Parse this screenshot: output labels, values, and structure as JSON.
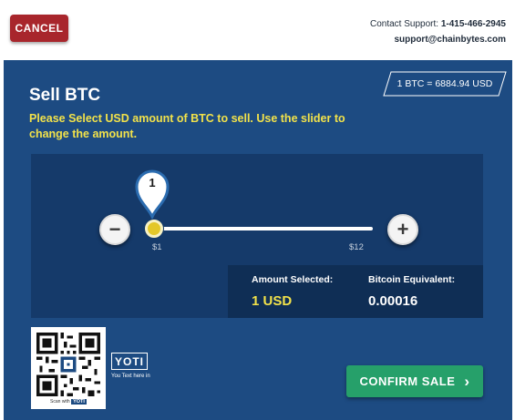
{
  "header": {
    "cancel_label": "CANCEL",
    "support_prefix": "Contact Support:",
    "support_phone": "1-415-466-2945",
    "support_email": "support@chainbytes.com"
  },
  "sell": {
    "title": "Sell BTC",
    "exchange_rate": "1 BTC = 6884.94 USD",
    "instructions": "Please Select USD amount of BTC to sell. Use the slider to change the amount."
  },
  "slider": {
    "current_value": "1",
    "min_label": "$1",
    "max_label": "$12",
    "minus_icon": "−",
    "plus_icon": "+",
    "position_fraction": 0
  },
  "summary": {
    "amount_label": "Amount Selected:",
    "amount_value": "1 USD",
    "btc_label": "Bitcoin Equivalent:",
    "btc_value": "0.00016"
  },
  "qr": {
    "caption_prefix": "Scan with",
    "caption_brand": "YOTI",
    "icon": "qr-code-icon"
  },
  "yoti": {
    "logo_text": "YOTI",
    "tagline": "You Text here in"
  },
  "confirm": {
    "label": "CONFIRM SALE",
    "chevron": "›"
  },
  "colors": {
    "background_blue": "#1d4b82",
    "panel_blue": "#153a6a",
    "accent_yellow": "#f2e24a",
    "cancel_red": "#a8262c",
    "confirm_green": "#26a06a"
  }
}
